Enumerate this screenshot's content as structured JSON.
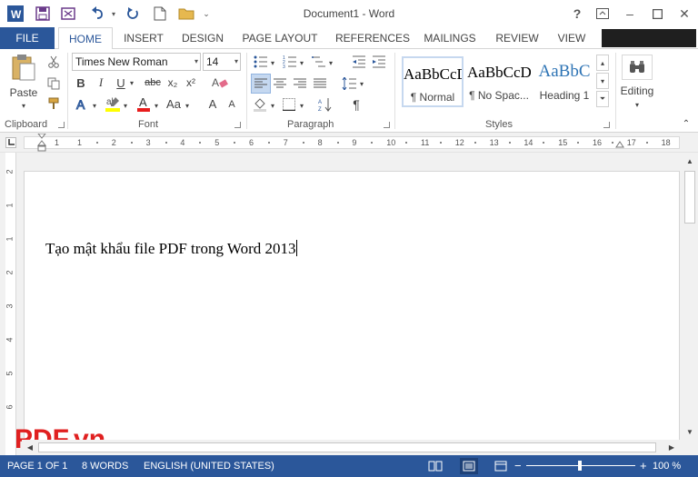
{
  "window": {
    "title": "Document1 - Word",
    "help": "?",
    "minimize": "–",
    "close": "✕"
  },
  "tabs": [
    "FILE",
    "HOME",
    "INSERT",
    "DESIGN",
    "PAGE LAYOUT",
    "REFERENCES",
    "MAILINGS",
    "REVIEW",
    "VIEW"
  ],
  "ribbon": {
    "clipboard": {
      "label": "Clipboard",
      "paste": "Paste"
    },
    "font": {
      "label": "Font",
      "name": "Times New Roman",
      "size": "14",
      "bold": "B",
      "italic": "I",
      "underline": "U",
      "strike": "abc",
      "subscript": "x₂",
      "superscript": "x²",
      "color_a": "A",
      "case": "Aa",
      "grow": "A",
      "shrink": "A"
    },
    "paragraph": {
      "label": "Paragraph",
      "pilcrow": "¶"
    },
    "styles": {
      "label": "Styles",
      "items": [
        {
          "sample": "AaBbCcDc",
          "name": "¶ Normal"
        },
        {
          "sample": "AaBbCcDc",
          "name": "¶ No Spac..."
        },
        {
          "sample": "AaBbC",
          "name": "Heading 1"
        }
      ]
    },
    "editing": {
      "label": "Editing"
    }
  },
  "ruler": {
    "marks": [
      "1",
      "1",
      "2",
      "3",
      "4",
      "5",
      "6",
      "7",
      "8",
      "9",
      "10",
      "11",
      "12",
      "13",
      "14",
      "15",
      "16",
      "17",
      "18"
    ],
    "vmarks": [
      "2",
      "1",
      "1",
      "2",
      "3",
      "4",
      "5",
      "6"
    ]
  },
  "document": {
    "text": "Tạo mật khẩu file PDF trong Word 2013"
  },
  "watermark": "PDF.vn",
  "status": {
    "page": "PAGE 1 OF 1",
    "words": "8 WORDS",
    "language": "ENGLISH (UNITED STATES)",
    "zoom_minus": "−",
    "zoom_plus": "+",
    "zoom": "100 %",
    "zoom_level": 1.0
  },
  "colors": {
    "accent": "#2b579a",
    "watermark": "#e02020"
  }
}
